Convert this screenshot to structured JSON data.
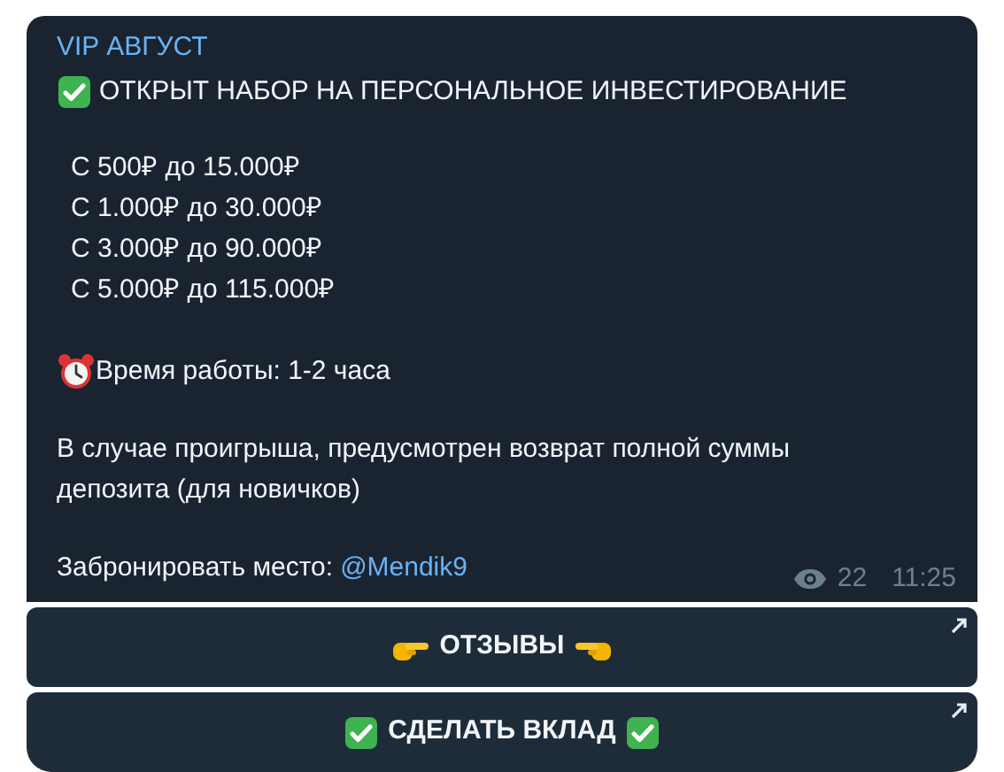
{
  "message": {
    "sender": "VIP АВГУСТ",
    "headline": "ОТКРЫТ НАБОР НА ПЕРСОНАЛЬНОЕ ИНВЕСТИРОВАНИЕ",
    "tiers": [
      "С 500₽ до 15.000₽",
      "С 1.000₽ до 30.000₽",
      "С 3.000₽ до 90.000₽",
      "С 5.000₽ до 115.000₽"
    ],
    "hours": "Время работы: 1-2 часа",
    "note": "В случае проигрыша, предусмотрен возврат полной суммы депозита (для новичков)",
    "booking": {
      "label": "Забронировать место:",
      "link": "@Mendik9"
    },
    "views": "22",
    "time": "11:25"
  },
  "buttons": [
    {
      "label": "ОТЗЫВЫ",
      "kind": "hands"
    },
    {
      "label": "СДЕЛАТЬ ВКЛАД",
      "kind": "checks"
    }
  ]
}
